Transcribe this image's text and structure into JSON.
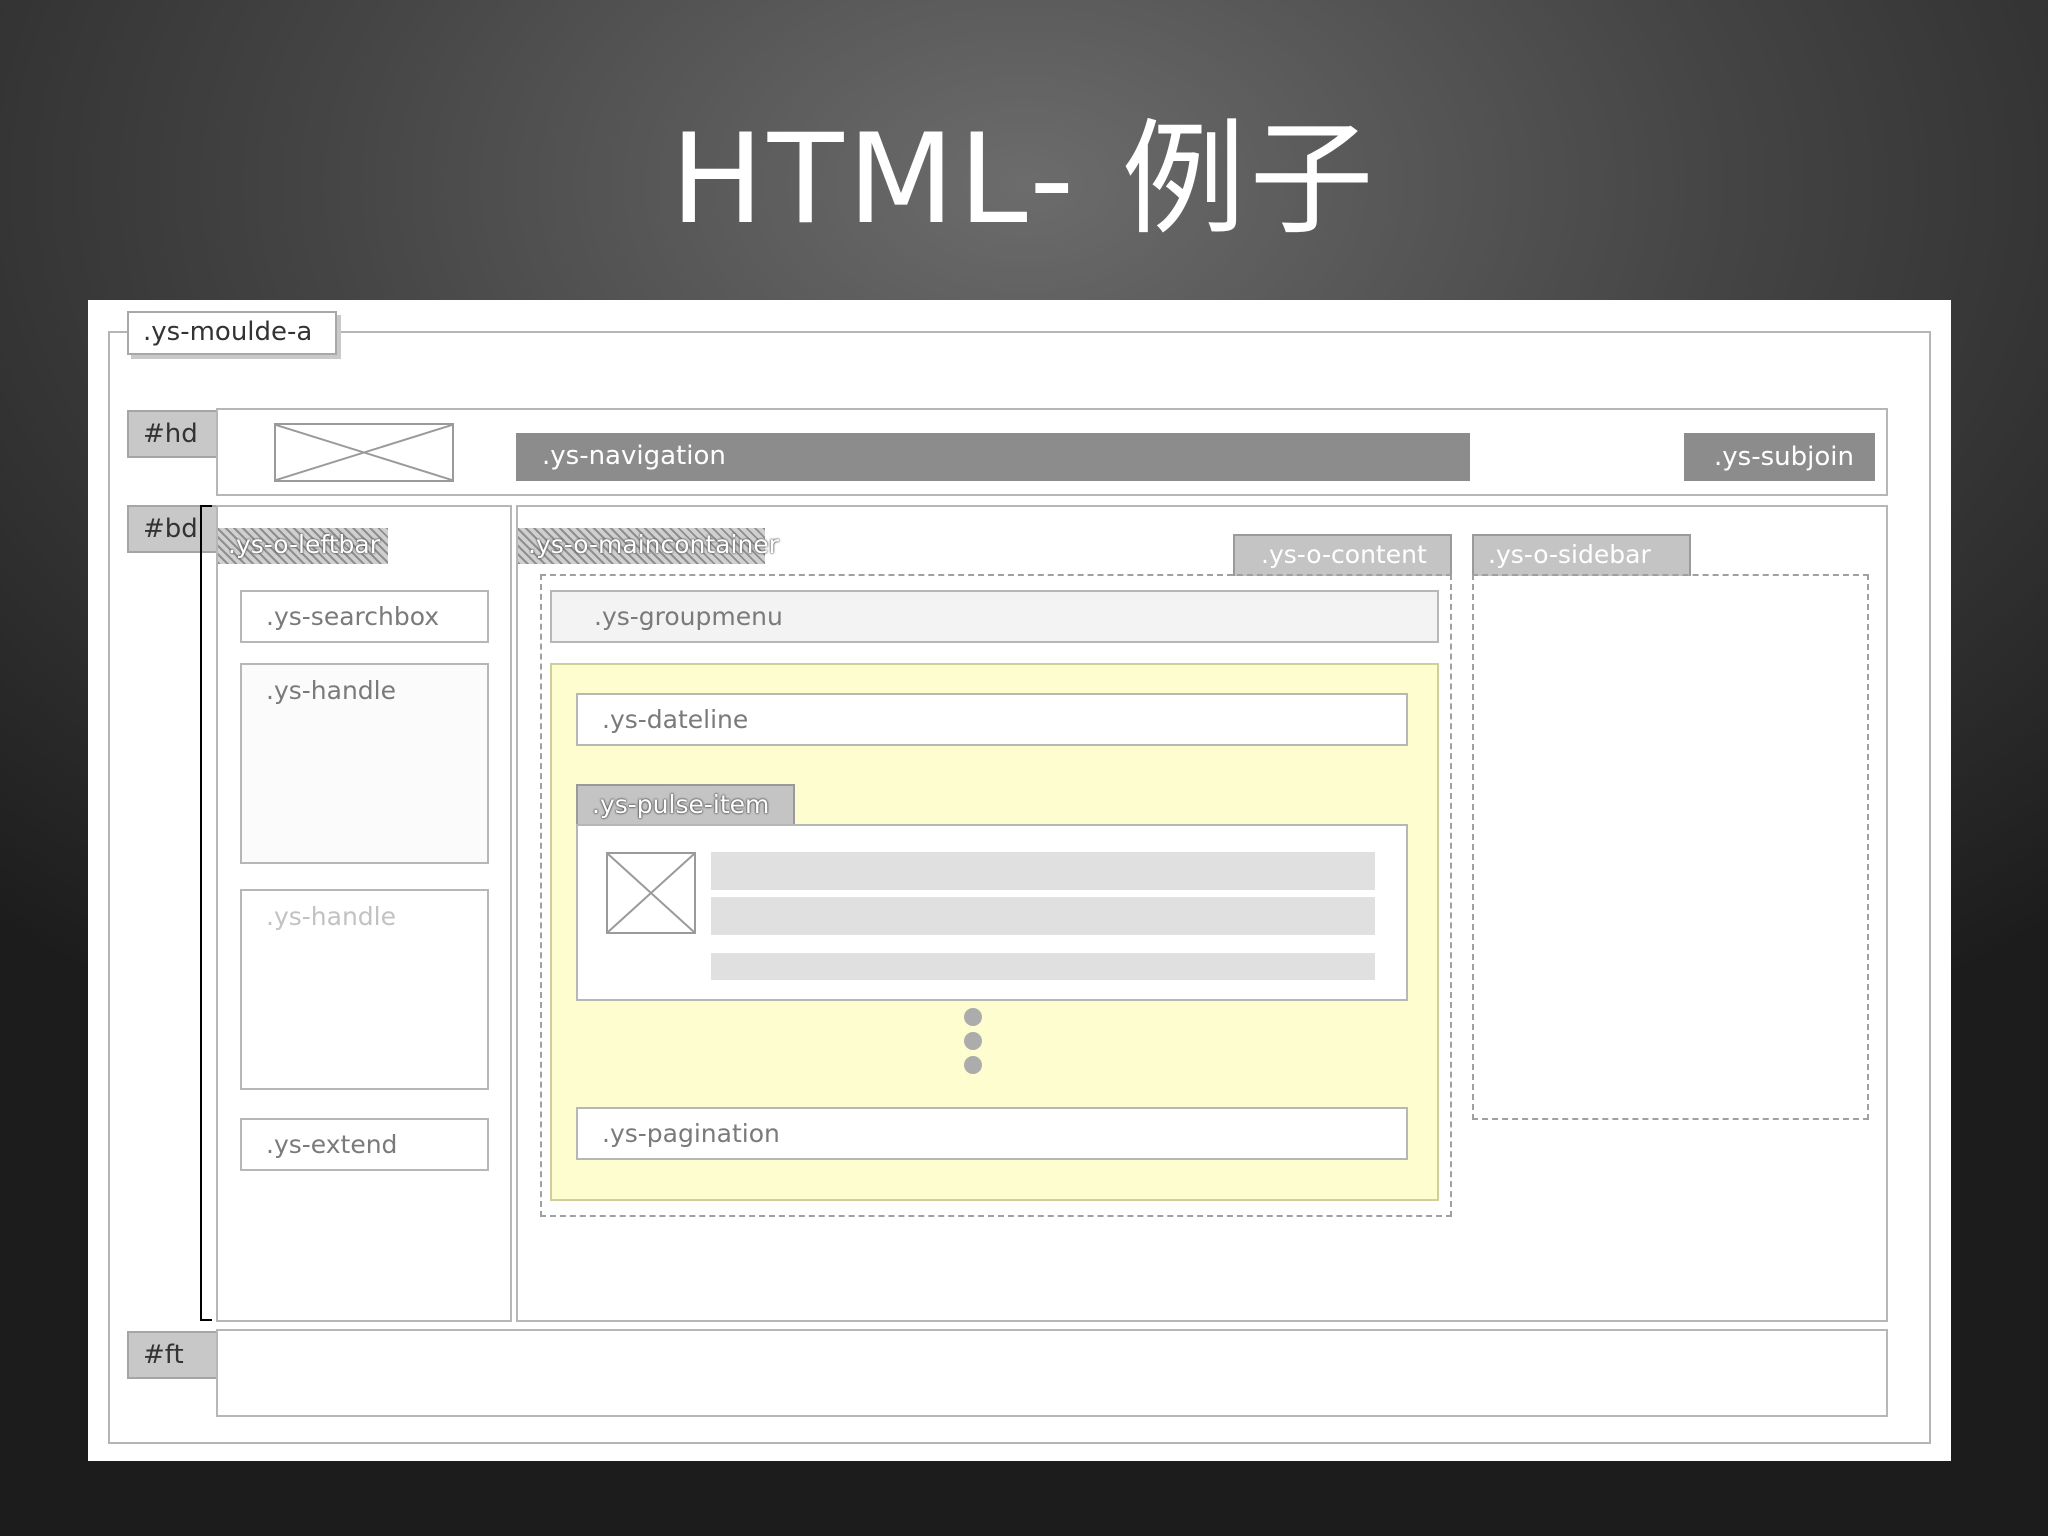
{
  "title": "HTML- 例子",
  "diagram": {
    "module": ".ys-moulde-a",
    "header": {
      "id": "#hd",
      "navigation": ".ys-navigation",
      "subjoin": ".ys-subjoin"
    },
    "body": {
      "id": "#bd",
      "leftbar": {
        "label": ".ys-o-leftbar",
        "searchbox": ".ys-searchbox",
        "handle1": ".ys-handle",
        "handle2": ".ys-handle",
        "extend": ".ys-extend"
      },
      "maincontainer": {
        "label": ".ys-o-maincontainer",
        "content_tab": ".ys-o-content",
        "groupmenu": ".ys-groupmenu",
        "dateline": ".ys-dateline",
        "pulse_item": ".ys-pulse-item",
        "pagination": ".ys-pagination"
      },
      "sidebar": {
        "label": ".ys-o-sidebar"
      }
    },
    "footer": {
      "id": "#ft"
    },
    "colors": {
      "content_fill": "#fefdd0",
      "content_border": "#cfcf9c",
      "bar_fill": "#8c8c8c"
    }
  }
}
